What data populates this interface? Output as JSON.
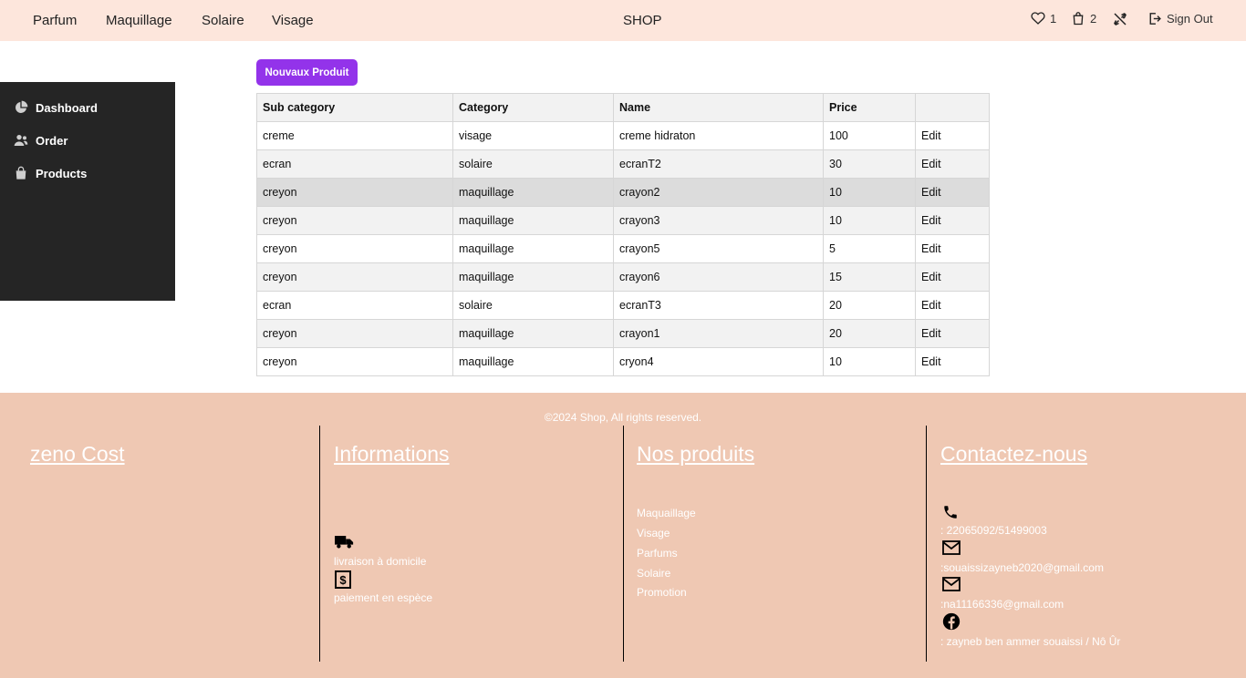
{
  "nav": {
    "links": [
      "Parfum",
      "Maquillage",
      "Solaire",
      "Visage"
    ],
    "brand": "SHOP",
    "wishlist_count": "1",
    "cart_count": "2",
    "signout_label": "Sign Out"
  },
  "sidebar": {
    "items": [
      {
        "label": "Dashboard",
        "icon": "pie-chart-icon"
      },
      {
        "label": "Order",
        "icon": "users-icon"
      },
      {
        "label": "Products",
        "icon": "shopping-bag-icon"
      }
    ]
  },
  "actions": {
    "new_product_label": "Nouvaux Produit"
  },
  "table": {
    "headers": [
      "Sub category",
      "Category",
      "Name",
      "Price",
      ""
    ],
    "edit_label": "Edit",
    "rows": [
      {
        "sub": "creme",
        "cat": "visage",
        "name": "creme hidraton",
        "price": "100"
      },
      {
        "sub": "ecran",
        "cat": "solaire",
        "name": "ecranT2",
        "price": "30"
      },
      {
        "sub": "creyon",
        "cat": "maquillage",
        "name": "crayon2",
        "price": "10"
      },
      {
        "sub": "creyon",
        "cat": "maquillage",
        "name": "crayon3",
        "price": "10"
      },
      {
        "sub": "creyon",
        "cat": "maquillage",
        "name": "crayon5",
        "price": "5"
      },
      {
        "sub": "creyon",
        "cat": "maquillage",
        "name": "crayon6",
        "price": "15"
      },
      {
        "sub": "ecran",
        "cat": "solaire",
        "name": "ecranT3",
        "price": "20"
      },
      {
        "sub": "creyon",
        "cat": "maquillage",
        "name": "crayon1",
        "price": "20"
      },
      {
        "sub": "creyon",
        "cat": "maquillage",
        "name": "cryon4",
        "price": "10"
      }
    ]
  },
  "footer": {
    "copyright": "©2024 Shop, All rights reserved.",
    "brand_heading": "zeno Cost",
    "info_heading": "Informations",
    "info_delivery": "livraison à domicile",
    "info_payment": "paiement en espèce",
    "products_heading": "Nos produits",
    "products_links": [
      "Maquaillage",
      "Visage",
      "Parfums",
      "Solaire",
      "Promotion"
    ],
    "contact_heading": "Contactez-nous",
    "contact_phone": ": 22065092/51499003",
    "contact_email1": ":souaissizayneb2020@gmail.com",
    "contact_email2": ":na11166336@gmail.com",
    "contact_facebook": ": zayneb ben ammer souaissi / Nô Ûr"
  },
  "colors": {
    "topbar_bg": "#fde6dc",
    "sidebar_bg": "#252525",
    "button_bg": "#9333ea",
    "footer_bg": "#efc8b3"
  }
}
